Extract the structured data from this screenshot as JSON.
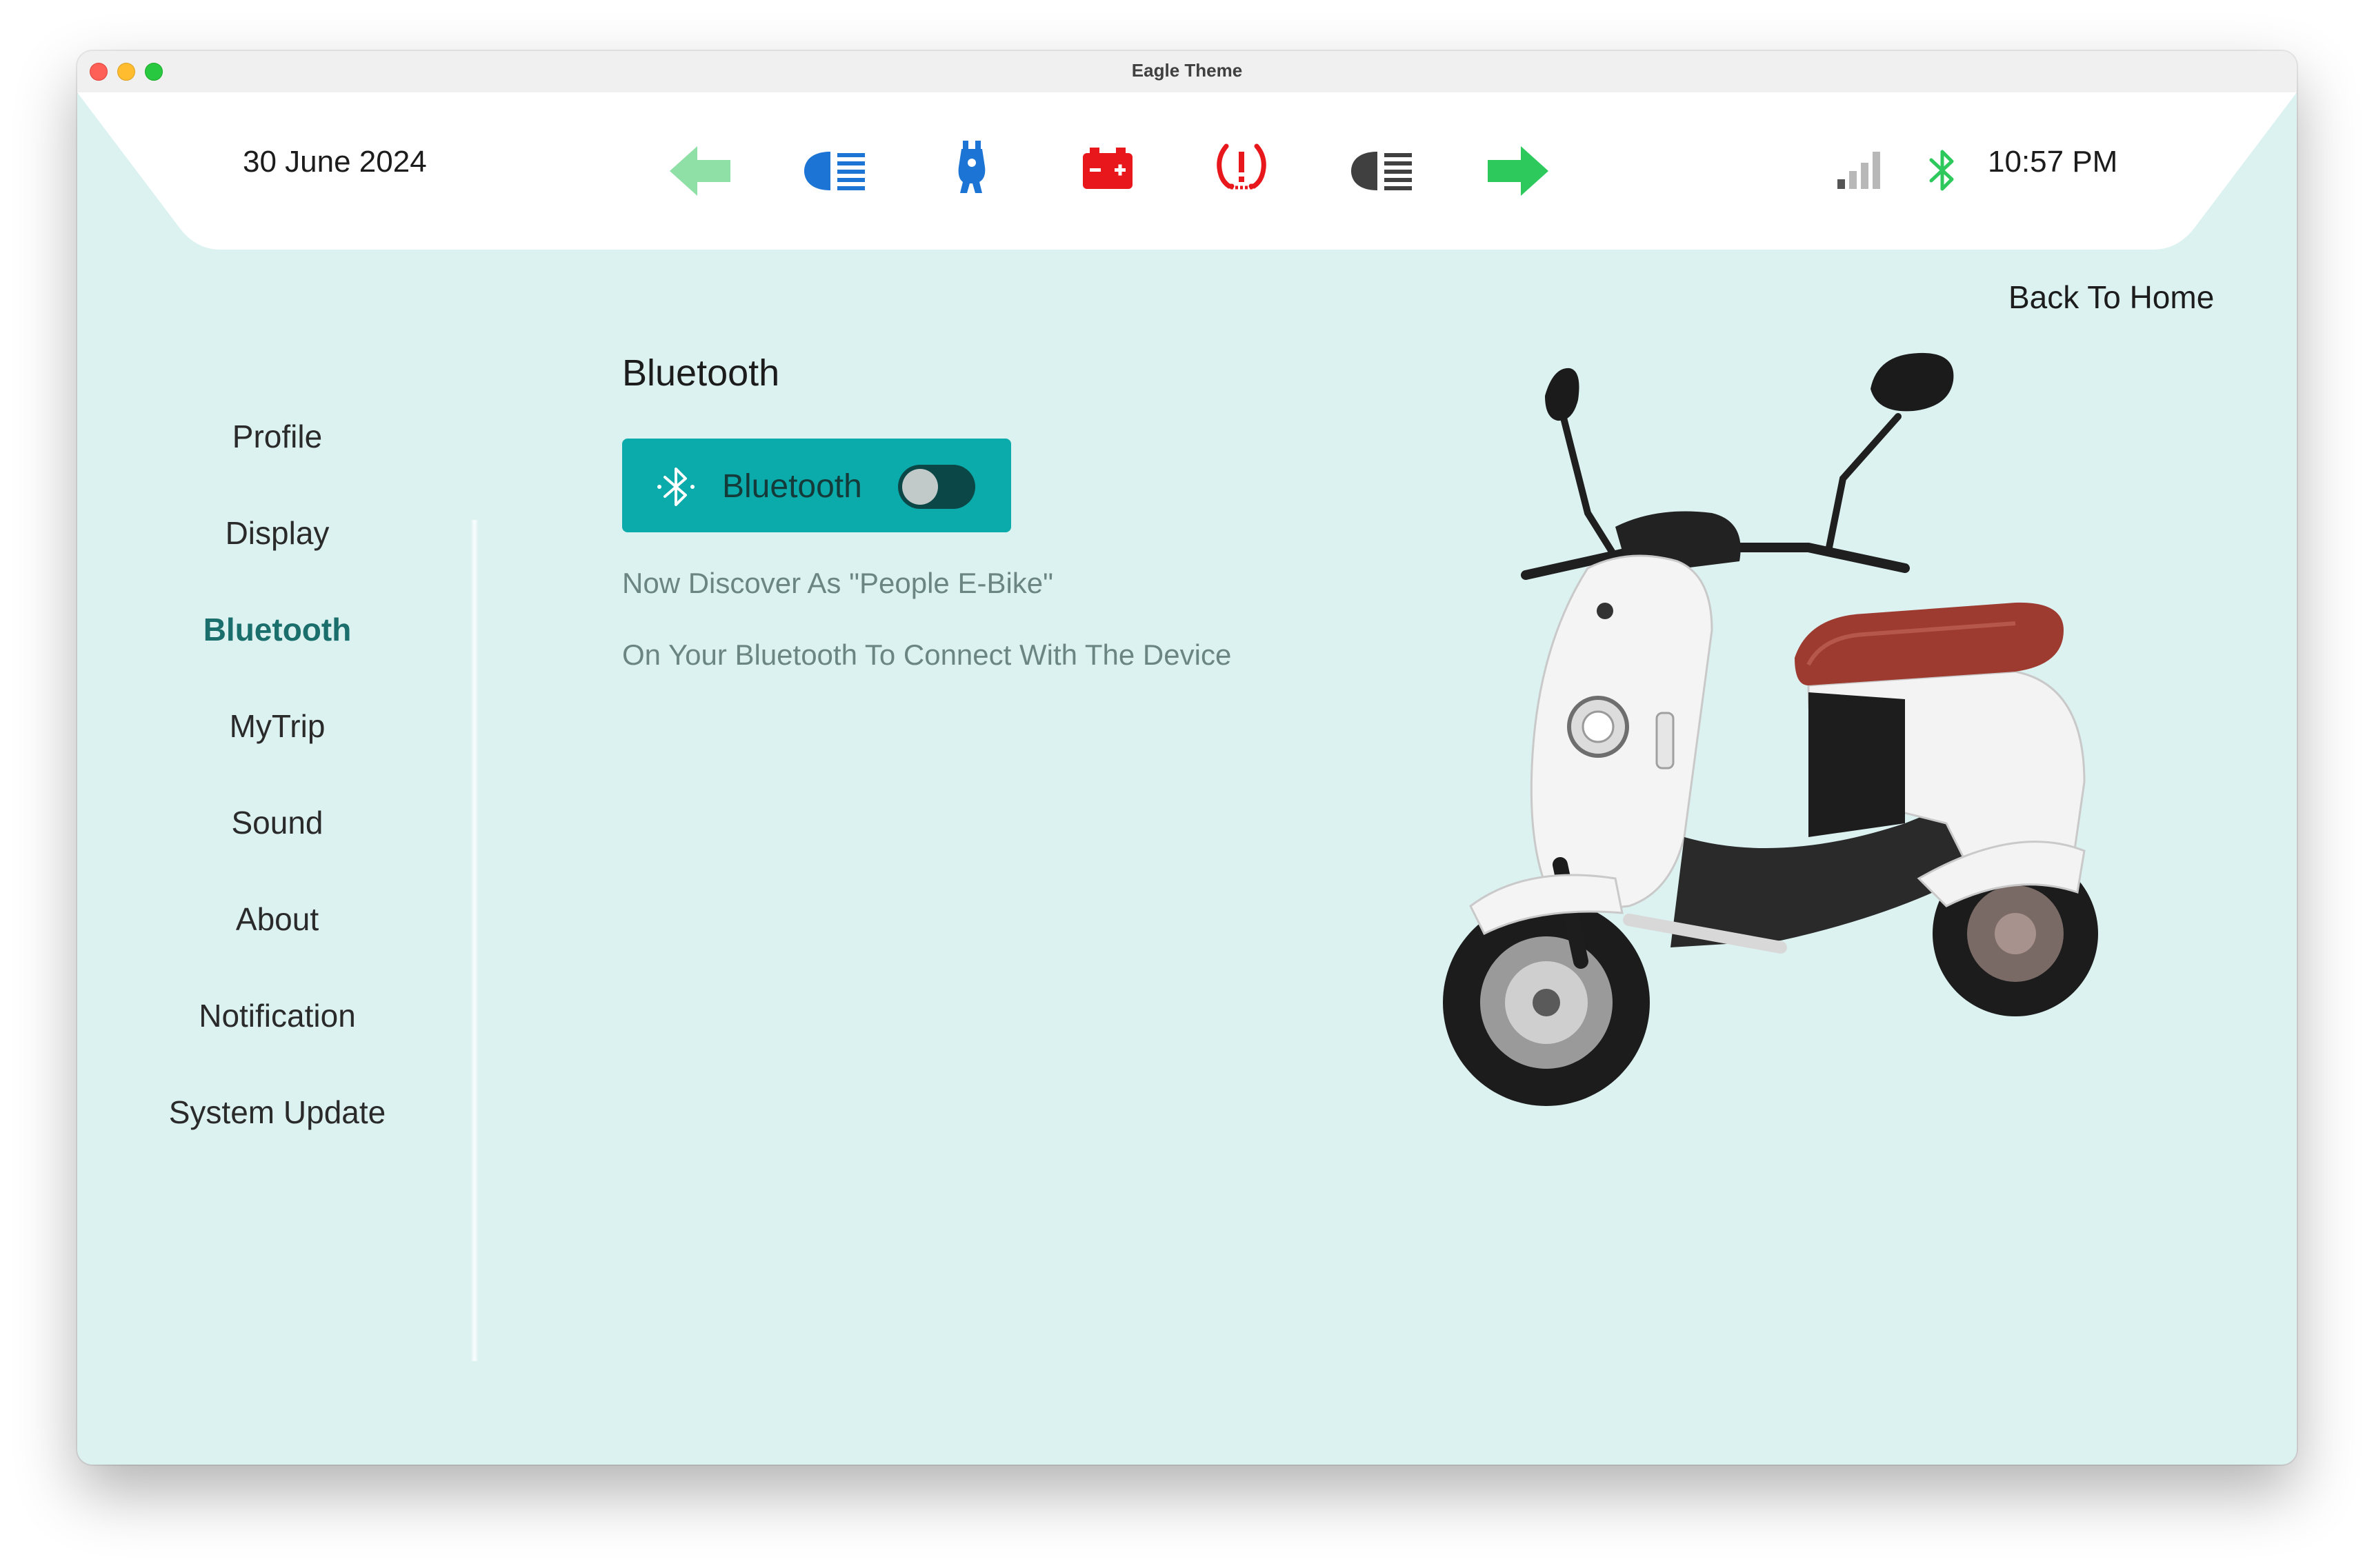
{
  "window": {
    "title": "Eagle Theme"
  },
  "status_bar": {
    "date": "30 June 2024",
    "time": "10:57 PM",
    "indicators": [
      {
        "icon": "left-turn-arrow-icon",
        "color": "#8ee0a6"
      },
      {
        "icon": "high-beam-headlight-icon",
        "color": "#1c74d4"
      },
      {
        "icon": "scooter-stand-icon",
        "color": "#1c74d4"
      },
      {
        "icon": "battery-warning-icon",
        "color": "#e8171c"
      },
      {
        "icon": "tire-pressure-warning-icon",
        "color": "#e8171c"
      },
      {
        "icon": "low-beam-headlight-icon",
        "color": "#404040"
      },
      {
        "icon": "right-turn-arrow-icon",
        "color": "#2ec95c"
      }
    ],
    "signal_icon": "signal-strength-icon",
    "bluetooth_icon": "bluetooth-icon",
    "bluetooth_color": "#2ec95c"
  },
  "sidebar": {
    "items": [
      {
        "label": "Profile"
      },
      {
        "label": "Display"
      },
      {
        "label": "Bluetooth",
        "active": true
      },
      {
        "label": "MyTrip"
      },
      {
        "label": "Sound"
      },
      {
        "label": "About"
      },
      {
        "label": "Notification"
      },
      {
        "label": "System Update"
      }
    ],
    "active_color": "#1a6e6c"
  },
  "header": {
    "back_link": "Back To Home"
  },
  "bluetooth": {
    "title": "Bluetooth",
    "card_label": "Bluetooth",
    "toggle_on": false,
    "card_color": "#0aabaa",
    "discover_text": "Now Discover As \"People E-Bike\"",
    "hint_text": "On Your Bluetooth To Connect With The Device"
  },
  "colors": {
    "background": "#dcf2f1",
    "text_muted": "#6b8583"
  }
}
